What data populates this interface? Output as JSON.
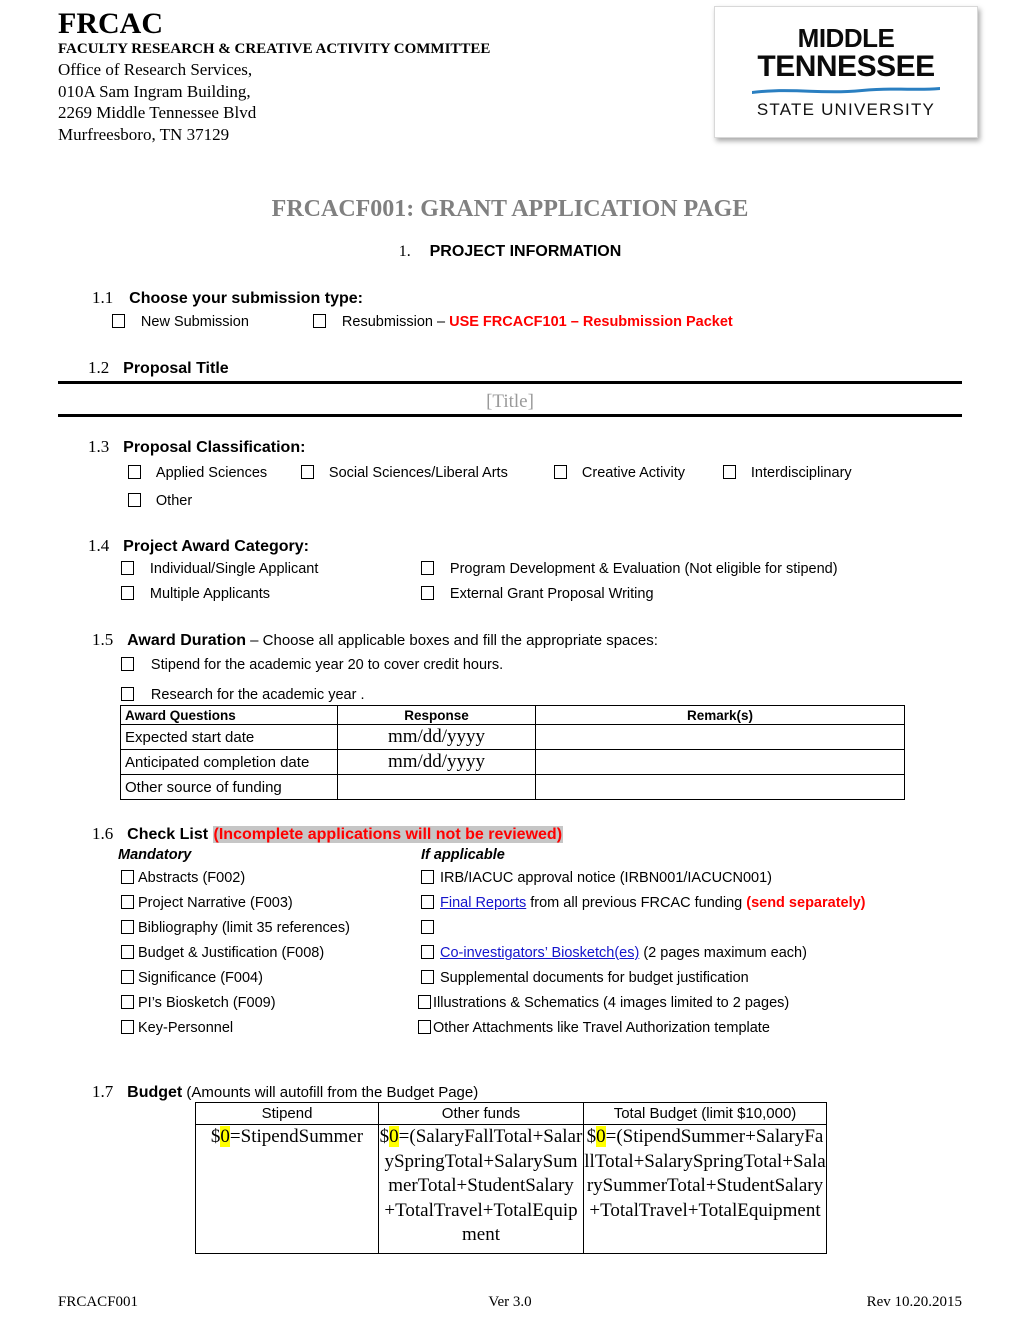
{
  "letterhead": {
    "org_abbr": "FRCAC",
    "org_full": "FACULTY RESEARCH & CREATIVE ACTIVITY COMMITTEE",
    "address_line1": "Office of Research Services,",
    "address_line2": "010A Sam Ingram Building,",
    "address_line3": "2269 Middle Tennessee Blvd",
    "address_line4": "Murfreesboro, TN 37129"
  },
  "logo": {
    "line1": "MIDDLE",
    "line2": "TENNESSEE",
    "line3": "STATE UNIVERSITY",
    "wave_color": "#2a7fc1"
  },
  "doc": {
    "title": "FRCACF001: GRANT APPLICATION PAGE",
    "title_color": "#808080",
    "section_number": "1.",
    "section_label": "PROJECT INFORMATION"
  },
  "q11": {
    "number": "1.1",
    "label": "Choose your submission type:",
    "option_new": "New Submission",
    "option_resub_prefix": "Resubmission – ",
    "option_resub_red": "USE FRCACF101 – Resubmission Packet"
  },
  "q12": {
    "number": "1.2",
    "label": "Proposal Title",
    "placeholder": "[Title]"
  },
  "q13": {
    "number": "1.3",
    "label": "Proposal Classification:",
    "options": [
      "Applied Sciences",
      "Social Sciences/Liberal Arts",
      "Creative Activity",
      "Interdisciplinary",
      "Other"
    ]
  },
  "q14": {
    "number": "1.4",
    "label": "Project Award Category:",
    "options_left": [
      "Individual/Single Applicant",
      "Multiple Applicants"
    ],
    "options_right": [
      "Program Development & Evaluation (Not eligible for stipend)",
      "External Grant Proposal Writing"
    ]
  },
  "q15": {
    "number": "1.5",
    "label": "Award Duration",
    "note": " – Choose all applicable boxes and fill the appropriate spaces:",
    "option_stipend": "Stipend for the academic year 20  to cover  credit hours.",
    "option_research": "Research for the academic year .",
    "table": {
      "headers": [
        "Award Questions",
        "Response",
        "Remark(s)"
      ],
      "rows": [
        {
          "question": "Expected start date",
          "response": "mm/dd/yyyy",
          "remark": ""
        },
        {
          "question": "Anticipated completion date",
          "response": "mm/dd/yyyy",
          "remark": ""
        },
        {
          "question": "Other source of funding",
          "response": "",
          "remark": ""
        }
      ]
    }
  },
  "q16": {
    "number": "1.6",
    "label": "Check List ",
    "warning": "(Incomplete applications will not be reviewed)",
    "warning_color": "#ff0000",
    "highlight_color": "#c6c6c6",
    "col_left_header": "Mandatory",
    "col_right_header": "If applicable",
    "mandatory": [
      "Abstracts (F002)",
      "Project Narrative (F003)",
      "Bibliography (limit 35 references)",
      "Budget & Justification (F008)",
      "Significance   (F004)",
      "PI’s Biosketch (F009)",
      "Key-Personnel"
    ],
    "applicable": [
      {
        "text": "IRB/IACUC approval notice (IRBN001/IACUCN001)"
      },
      {
        "link": "Final Reports",
        "text": " from all previous FRCAC funding ",
        "red": "(send separately)"
      },
      {
        "text": ""
      },
      {
        "link": "Co-investigators’ Biosketch(es)",
        "text": " (2 pages maximum each)"
      },
      {
        "text": "Supplemental documents for budget justification"
      },
      {
        "text": "Illustrations & Schematics (4 images limited to 2 pages)"
      },
      {
        "text": "Other Attachments like Travel Authorization template"
      }
    ]
  },
  "q17": {
    "number": "1.7",
    "label": "Budget",
    "note": " (Amounts will autofill from the Budget Page)",
    "headers": [
      "Stipend",
      "Other funds",
      "Total Budget (limit $10,000)"
    ],
    "highlight_color": "#ffff00",
    "cells": [
      {
        "prefix": "$",
        "zero": "0",
        "formula": "=StipendSummer"
      },
      {
        "prefix": "$",
        "zero": "0",
        "formula": "=(SalaryFallTotal+SalarySpringTotal+SalarySummerTotal+StudentSalary\n+TotalTravel+TotalEquipment"
      },
      {
        "prefix": "$",
        "zero": "0",
        "formula": "=(StipendSummer+SalaryFallTotal+SalarySpringTotal+SalarySummerTotal+StudentSalary\n+TotalTravel+TotalEquipment"
      }
    ]
  },
  "footer": {
    "left": "FRCACF001",
    "center": "Ver 3.0",
    "right": "Rev 10.20.2015"
  }
}
